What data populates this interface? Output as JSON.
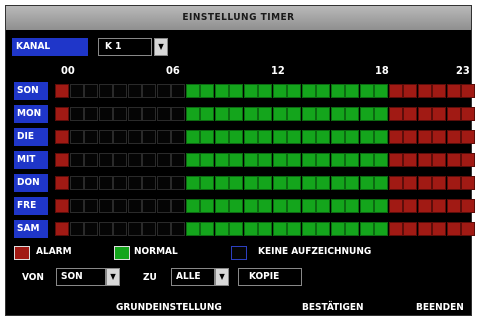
{
  "window": {
    "title": "EINSTELLUNG TIMER"
  },
  "channel": {
    "label": "KANAL",
    "value": "K 1"
  },
  "hours": [
    "00",
    "06",
    "12",
    "18",
    "23"
  ],
  "schedule": {
    "days": [
      "SON",
      "MON",
      "DIE",
      "MIT",
      "DON",
      "FRE",
      "SAM"
    ],
    "pattern": [
      "alarm",
      "none",
      "none",
      "none",
      "none",
      "none",
      "none",
      "none",
      "none",
      "normal",
      "normal",
      "normal",
      "normal",
      "normal",
      "normal",
      "normal",
      "normal",
      "normal",
      "normal",
      "normal",
      "normal",
      "normal",
      "normal",
      "alarm",
      "alarm",
      "alarm",
      "alarm",
      "alarm",
      "alarm"
    ]
  },
  "legend": {
    "alarm": "ALARM",
    "normal": "NORMAL",
    "none": "KEINE AUFZEICHNUNG"
  },
  "copy": {
    "from_label": "VON",
    "from_value": "SON",
    "to_label": "ZU",
    "to_value": "ALLE",
    "copy_button": "KOPIE"
  },
  "footer": {
    "default_button": "GRUNDEINSTELLUNG",
    "confirm_button": "BESTÄTIGEN",
    "exit_button": "BEENDEN"
  },
  "colors": {
    "alarm": "#a11a14",
    "normal": "#14a51c",
    "none": "#050505",
    "accent": "#1f36c9"
  }
}
